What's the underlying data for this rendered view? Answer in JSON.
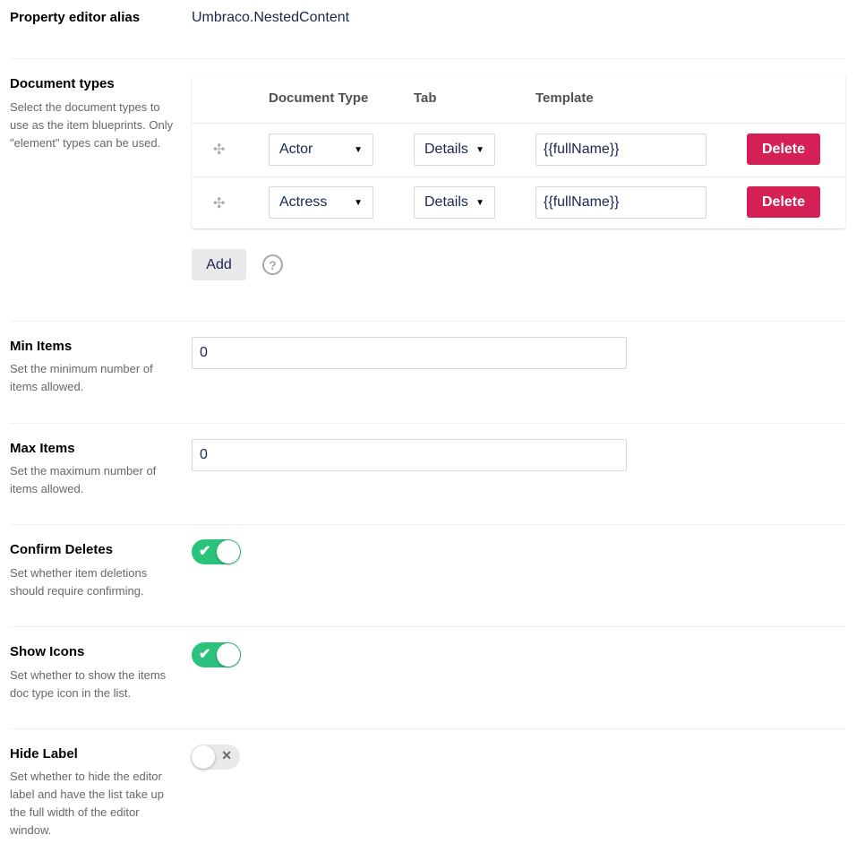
{
  "alias": {
    "label": "Property editor alias",
    "value": "Umbraco.NestedContent"
  },
  "document_types": {
    "label": "Document types",
    "description": "Select the document types to use as the item blueprints. Only \"element\" types can be used.",
    "columns": [
      "Document Type",
      "Tab",
      "Template"
    ],
    "rows": [
      {
        "document_type": "Actor",
        "tab": "Details",
        "template": "{{fullName}}",
        "delete_label": "Delete"
      },
      {
        "document_type": "Actress",
        "tab": "Details",
        "template": "{{fullName}}",
        "delete_label": "Delete"
      }
    ],
    "add_label": "Add",
    "help_glyph": "?"
  },
  "min_items": {
    "label": "Min Items",
    "description": "Set the minimum number of items allowed.",
    "value": "0"
  },
  "max_items": {
    "label": "Max Items",
    "description": "Set the maximum number of items allowed.",
    "value": "0"
  },
  "confirm_deletes": {
    "label": "Confirm Deletes",
    "description": "Set whether item deletions should require confirming.",
    "enabled": true
  },
  "show_icons": {
    "label": "Show Icons",
    "description": "Set whether to show the items doc type icon in the list.",
    "enabled": true
  },
  "hide_label": {
    "label": "Hide Label",
    "description": "Set whether to hide the editor label and have the list take up the full width of the editor window.",
    "enabled": false
  },
  "colors": {
    "accent_green": "#2bc37c",
    "delete_red": "#d42054",
    "text_dark": "#1b264f"
  },
  "icons": {
    "drag": "drag-handle-icon",
    "caret": "caret-down-icon",
    "help": "help-circle-icon",
    "check": "check-icon",
    "cross": "cross-icon"
  }
}
